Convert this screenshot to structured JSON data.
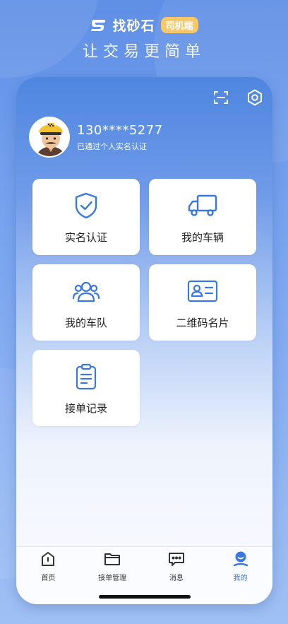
{
  "brand": {
    "name": "找砂石",
    "badge": "司机端",
    "slogan": "让交易更简单"
  },
  "header_icons": [
    "scan-icon",
    "settings-icon"
  ],
  "profile": {
    "phone": "130****5277",
    "status": "已通过个人实名认证"
  },
  "tiles": [
    {
      "label": "实名认证",
      "icon": "shield-check-icon"
    },
    {
      "label": "我的车辆",
      "icon": "truck-icon"
    },
    {
      "label": "我的车队",
      "icon": "team-icon"
    },
    {
      "label": "二维码名片",
      "icon": "id-card-icon"
    },
    {
      "label": "接单记录",
      "icon": "clipboard-icon"
    }
  ],
  "tabbar": [
    {
      "label": "首页",
      "icon": "home-icon"
    },
    {
      "label": "接单管理",
      "icon": "folder-icon"
    },
    {
      "label": "消息",
      "icon": "message-icon"
    },
    {
      "label": "我的",
      "icon": "user-icon",
      "active": true
    }
  ],
  "colors": {
    "accent": "#3a78e0",
    "badge": "#f6c86a"
  }
}
